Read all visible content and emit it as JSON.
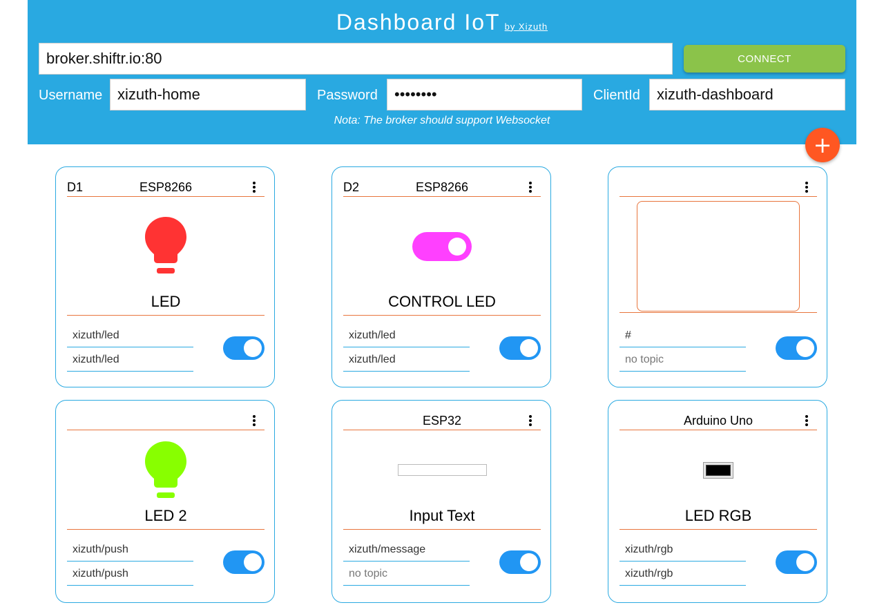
{
  "header": {
    "title": "Dashboard IoT",
    "byline": "by Xizuth",
    "broker_value": "broker.shiftr.io:80",
    "connect_label": "CONNECT",
    "username_label": "Username",
    "username_value": "xizuth-home",
    "password_label": "Password",
    "password_value": "password",
    "clientid_label": "ClientId",
    "clientid_value": "xizuth-dashboard",
    "note": "Nota: The broker should support Websocket",
    "add_icon": "plus-icon",
    "add_symbol": "+"
  },
  "colors": {
    "header_bg": "#29a9e1",
    "connect_bg": "#8bc34a",
    "fab_bg": "#ff5722",
    "toggle_on": "#2196f3",
    "divider": "#e8743b"
  },
  "cards": [
    {
      "id": "D1",
      "board": "ESP8266",
      "widget": "bulb",
      "widget_color": "#ff3333",
      "title": "LED",
      "topic_sub": "xizuth/led",
      "topic_pub": "xizuth/led",
      "placeholder": "no topic",
      "enabled": true
    },
    {
      "id": "D2",
      "board": "ESP8266",
      "widget": "switch",
      "widget_color": "#ff40ff",
      "title": "CONTROL LED",
      "topic_sub": "xizuth/led",
      "topic_pub": "xizuth/led",
      "placeholder": "no topic",
      "enabled": true
    },
    {
      "id": "",
      "board": "",
      "widget": "textarea",
      "widget_color": "#e8743b",
      "title": "",
      "topic_sub": "#",
      "topic_pub": "",
      "placeholder": "no topic",
      "enabled": true
    },
    {
      "id": "",
      "board": "",
      "widget": "bulb",
      "widget_color": "#88ff00",
      "title": "LED 2",
      "topic_sub": "xizuth/push",
      "topic_pub": "xizuth/push",
      "placeholder": "no topic",
      "enabled": true
    },
    {
      "id": "",
      "board": "ESP32",
      "widget": "text-input",
      "widget_color": "#ffffff",
      "title": "Input Text",
      "topic_sub": "xizuth/message",
      "topic_pub": "",
      "placeholder": "no topic",
      "enabled": true
    },
    {
      "id": "",
      "board": "Arduino Uno",
      "widget": "color-picker",
      "widget_color": "#000000",
      "title": "LED RGB",
      "topic_sub": "xizuth/rgb",
      "topic_pub": "xizuth/rgb",
      "placeholder": "no topic",
      "enabled": true
    }
  ]
}
